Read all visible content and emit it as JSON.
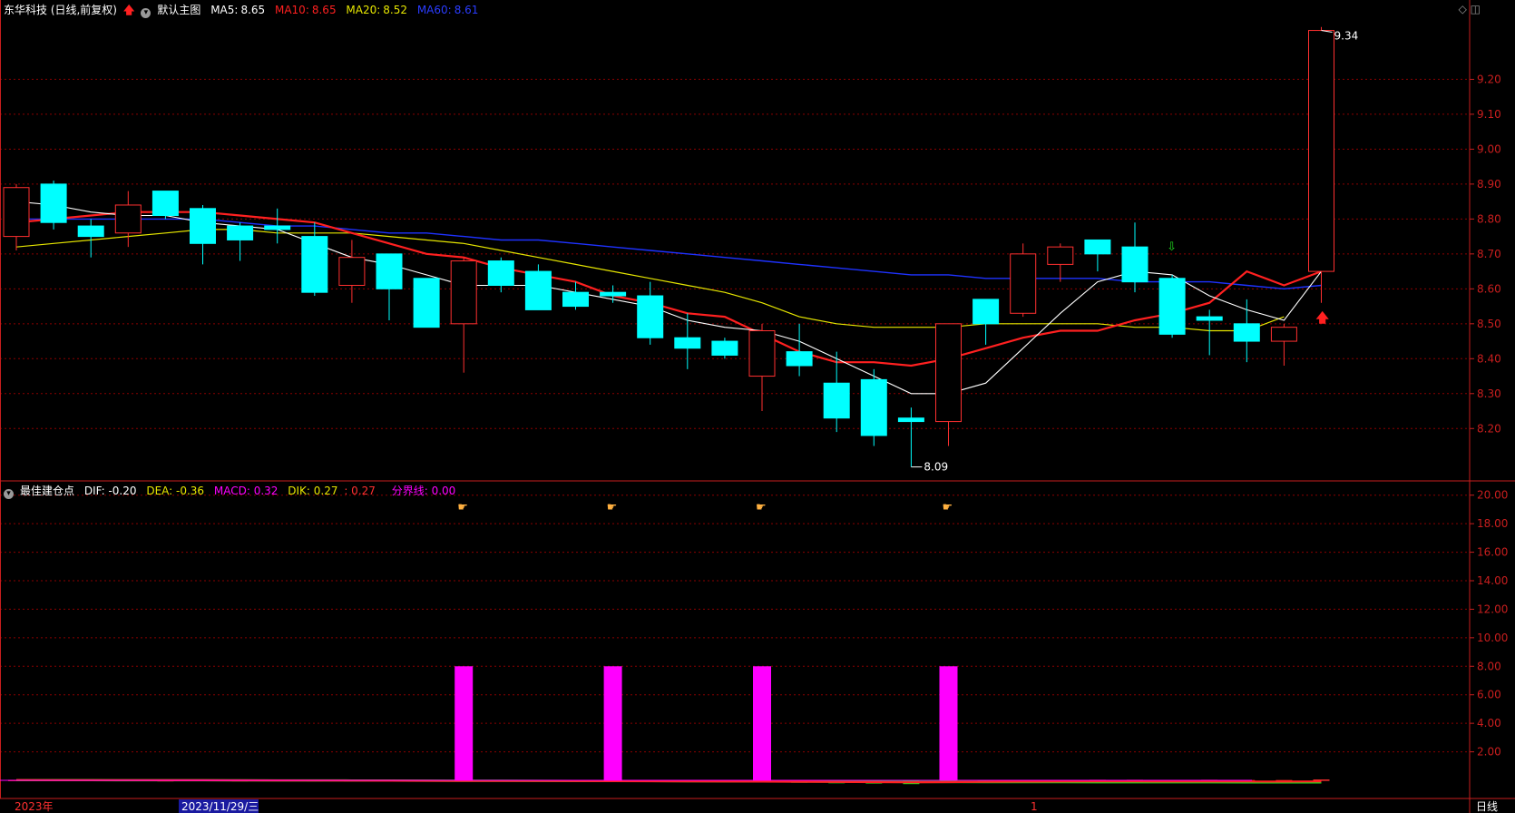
{
  "header": {
    "stock_title": "东华科技 (日线,前复权)",
    "main_chart_label": "默认主图",
    "ma5_label": "MA5:",
    "ma5_value": "8.65",
    "ma10_label": "MA10:",
    "ma10_value": "8.65",
    "ma20_label": "MA20:",
    "ma20_value": "8.52",
    "ma60_label": "MA60:",
    "ma60_value": "8.61"
  },
  "indicator_header": {
    "name": "最佳建仓点",
    "dif": "DIF: -0.20",
    "dea": "DEA: -0.36",
    "macd": "MACD: 0.32",
    "dik": "DIK: 0.27",
    "extra": ": 0.27",
    "divider": "分界线: 0.00"
  },
  "footer": {
    "year_label": "2023年",
    "date_label": "2023/11/29/三",
    "month_label": "1",
    "period_label": "日线"
  },
  "colors": {
    "up": "#ff3030",
    "down": "#00ffff",
    "ma5": "#ffffff",
    "ma10": "#ff2020",
    "ma20": "#e6e600",
    "ma60": "#1e32ff",
    "macd_bar": "#ff00ff",
    "grid": "#8b0000",
    "axis": "#c81e1e"
  },
  "chart_data": [
    {
      "type": "candlestick",
      "title": "东华科技",
      "y_ticks": [
        8.2,
        8.3,
        8.4,
        8.5,
        8.6,
        8.7,
        8.8,
        8.9,
        9.0,
        9.1,
        9.2
      ],
      "ylim": [
        8.05,
        9.37
      ],
      "candles": [
        [
          8.75,
          8.89,
          8.71,
          8.9
        ],
        [
          8.9,
          8.79,
          8.77,
          8.91
        ],
        [
          8.78,
          8.75,
          8.69,
          8.8
        ],
        [
          8.76,
          8.84,
          8.72,
          8.88
        ],
        [
          8.88,
          8.81,
          8.8,
          8.88
        ],
        [
          8.83,
          8.73,
          8.67,
          8.84
        ],
        [
          8.78,
          8.74,
          8.68,
          8.79
        ],
        [
          8.78,
          8.77,
          8.73,
          8.83
        ],
        [
          8.75,
          8.59,
          8.58,
          8.79
        ],
        [
          8.61,
          8.69,
          8.56,
          8.74
        ],
        [
          8.7,
          8.6,
          8.51,
          8.7
        ],
        [
          8.63,
          8.49,
          8.49,
          8.63
        ],
        [
          8.5,
          8.68,
          8.36,
          8.69
        ],
        [
          8.68,
          8.61,
          8.59,
          8.69
        ],
        [
          8.65,
          8.54,
          8.54,
          8.67
        ],
        [
          8.59,
          8.55,
          8.54,
          8.62
        ],
        [
          8.59,
          8.58,
          8.56,
          8.61
        ],
        [
          8.58,
          8.46,
          8.44,
          8.62
        ],
        [
          8.46,
          8.43,
          8.37,
          8.53
        ],
        [
          8.45,
          8.41,
          8.4,
          8.46
        ],
        [
          8.35,
          8.48,
          8.25,
          8.5
        ],
        [
          8.42,
          8.38,
          8.35,
          8.5
        ],
        [
          8.33,
          8.23,
          8.19,
          8.42
        ],
        [
          8.34,
          8.18,
          8.15,
          8.37
        ],
        [
          8.23,
          8.22,
          8.09,
          8.26
        ],
        [
          8.22,
          8.5,
          8.15,
          8.5
        ],
        [
          8.57,
          8.5,
          8.44,
          8.57
        ],
        [
          8.53,
          8.7,
          8.52,
          8.73
        ],
        [
          8.67,
          8.72,
          8.62,
          8.73
        ],
        [
          8.74,
          8.7,
          8.65,
          8.74
        ],
        [
          8.72,
          8.62,
          8.59,
          8.79
        ],
        [
          8.63,
          8.47,
          8.46,
          8.64
        ],
        [
          8.52,
          8.51,
          8.41,
          8.54
        ],
        [
          8.5,
          8.45,
          8.39,
          8.57
        ],
        [
          8.45,
          8.49,
          8.38,
          8.5
        ],
        [
          8.65,
          9.34,
          8.56,
          9.35
        ]
      ],
      "ma5": [
        8.85,
        8.84,
        8.82,
        8.81,
        8.81,
        8.79,
        8.78,
        8.77,
        8.73,
        8.69,
        8.67,
        8.64,
        8.61,
        8.61,
        8.61,
        8.59,
        8.57,
        8.55,
        8.51,
        8.49,
        8.48,
        8.45,
        8.4,
        8.35,
        8.3,
        8.3,
        8.33,
        8.43,
        8.53,
        8.62,
        8.65,
        8.64,
        8.58,
        8.54,
        8.51,
        8.65
      ],
      "ma10": [
        8.79,
        8.8,
        8.81,
        8.82,
        8.82,
        8.82,
        8.81,
        8.8,
        8.79,
        8.76,
        8.73,
        8.7,
        8.69,
        8.66,
        8.64,
        8.62,
        8.58,
        8.56,
        8.53,
        8.52,
        8.47,
        8.42,
        8.39,
        8.39,
        8.38,
        8.4,
        8.43,
        8.46,
        8.48,
        8.48,
        8.51,
        8.53,
        8.56,
        8.65,
        8.61,
        8.65
      ],
      "ma20": [
        8.72,
        8.73,
        8.74,
        8.75,
        8.76,
        8.77,
        8.77,
        8.76,
        8.76,
        8.76,
        8.75,
        8.74,
        8.73,
        8.71,
        8.69,
        8.67,
        8.65,
        8.63,
        8.61,
        8.59,
        8.56,
        8.52,
        8.5,
        8.49,
        8.49,
        8.49,
        8.5,
        8.5,
        8.5,
        8.5,
        8.49,
        8.49,
        8.48,
        8.48,
        8.52
      ],
      "ma60": [
        8.8,
        8.8,
        8.8,
        8.8,
        8.8,
        8.8,
        8.79,
        8.78,
        8.78,
        8.77,
        8.76,
        8.76,
        8.75,
        8.74,
        8.74,
        8.73,
        8.72,
        8.71,
        8.7,
        8.69,
        8.68,
        8.67,
        8.66,
        8.65,
        8.64,
        8.64,
        8.63,
        8.63,
        8.63,
        8.63,
        8.62,
        8.62,
        8.62,
        8.61,
        8.6,
        8.61
      ],
      "annotations": [
        {
          "index": 35,
          "value": 9.34,
          "text": "9.34",
          "kind": "high"
        },
        {
          "index": 24,
          "value": 8.09,
          "text": "8.09",
          "kind": "low"
        }
      ],
      "signals": [
        {
          "index": 31,
          "kind": "down-arrow"
        },
        {
          "index": 35,
          "kind": "up-arrow"
        }
      ]
    },
    {
      "type": "bar",
      "title": "最佳建仓点",
      "y_ticks": [
        2,
        4,
        6,
        8,
        10,
        12,
        14,
        16,
        18,
        20
      ],
      "y_tick_labels": [
        "2.00",
        "4.00",
        "6.00",
        "8.00",
        "10.00",
        "12.00",
        "14.00",
        "16.00",
        "18.00",
        "20.00"
      ],
      "ylim": [
        0,
        21
      ],
      "signal_bars": [
        {
          "index": 12,
          "value": 8
        },
        {
          "index": 16,
          "value": 8
        },
        {
          "index": 20,
          "value": 8
        },
        {
          "index": 25,
          "value": 8
        }
      ],
      "hand_icons": [
        12,
        16,
        20,
        25
      ],
      "macd_hist": [
        0.02,
        0.03,
        0.02,
        0.03,
        0.01,
        0.02,
        0.01,
        0.02,
        0.01,
        0.0,
        -0.01,
        -0.02,
        -0.03,
        -0.02,
        -0.03,
        -0.04,
        -0.03,
        -0.05,
        -0.06,
        -0.07,
        -0.08,
        -0.09,
        -0.11,
        -0.12,
        -0.14,
        -0.1,
        -0.06,
        -0.03,
        0.01,
        0.02,
        0.02,
        0.01,
        0.02,
        0.01,
        0.01,
        0.03
      ],
      "dif": [
        0.05,
        0.04,
        0.04,
        0.03,
        0.02,
        0.01,
        0.0,
        -0.02,
        -0.04,
        -0.05,
        -0.07,
        -0.09,
        -0.1,
        -0.11,
        -0.12,
        -0.13,
        -0.15,
        -0.17,
        -0.19,
        -0.21,
        -0.23,
        -0.26,
        -0.3,
        -0.33,
        -0.36,
        -0.33,
        -0.29,
        -0.24,
        -0.21,
        -0.19,
        -0.2,
        -0.21,
        -0.22,
        -0.22,
        -0.23,
        -0.2
      ],
      "dea": [
        0.03,
        0.03,
        0.03,
        0.02,
        0.02,
        0.01,
        0.0,
        -0.01,
        -0.02,
        -0.03,
        -0.05,
        -0.07,
        -0.08,
        -0.09,
        -0.1,
        -0.11,
        -0.13,
        -0.14,
        -0.16,
        -0.18,
        -0.2,
        -0.22,
        -0.25,
        -0.28,
        -0.31,
        -0.32,
        -0.33,
        -0.33,
        -0.34,
        -0.35,
        -0.35,
        -0.35,
        -0.35,
        -0.36,
        -0.36,
        -0.36
      ]
    }
  ]
}
